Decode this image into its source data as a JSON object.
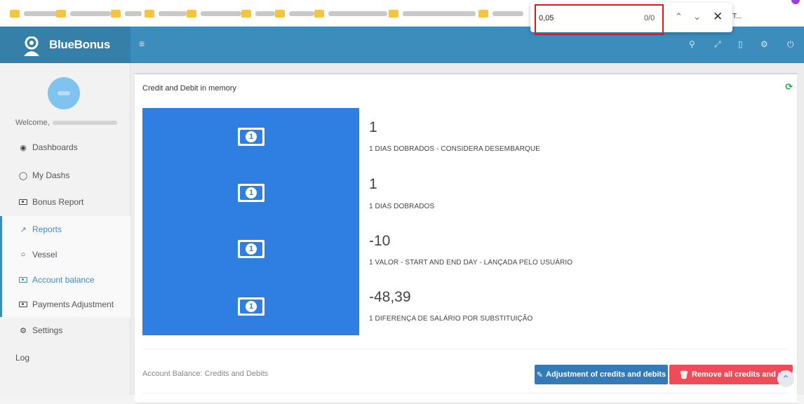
{
  "find_bar": {
    "query": "0,05",
    "count": "0/0",
    "tab_tail": "T..."
  },
  "navbar": {
    "brand": "BlueBonus",
    "icons": [
      "search-icon",
      "expand-icon",
      "window-icon",
      "settings-icon",
      "power-icon"
    ]
  },
  "sidebar": {
    "welcome": "Welcome,",
    "items": [
      {
        "label": "Dashboards",
        "icon": "dashboard-icon"
      },
      {
        "label": "My Dashs",
        "icon": "user-icon"
      },
      {
        "label": "Bonus Report",
        "icon": "money-icon"
      },
      {
        "label": "Reports",
        "icon": "chart-icon"
      },
      {
        "label": "Vessel",
        "icon": "circle-icon"
      },
      {
        "label": "Account balance",
        "icon": "money-icon"
      },
      {
        "label": "Payments Adjustment",
        "icon": "money-icon"
      },
      {
        "label": "Settings",
        "icon": "gears-icon"
      },
      {
        "label": "Log",
        "icon": ""
      }
    ]
  },
  "main": {
    "box_title": "Credit and Debit in memory",
    "stats": [
      {
        "value": "1",
        "desc": "1 DIAS DOBRADOS - CONSIDERA DESEMBARQUE"
      },
      {
        "value": "1",
        "desc": "1 DIAS DOBRADOS"
      },
      {
        "value": "-10",
        "desc": "1 VALOR - START AND END DAY - LANÇADA PELO USUÁRIO"
      },
      {
        "value": "-48,39",
        "desc": "1 DIFERENÇA DE SALÁRIO POR SUBSTITUIÇÃO"
      }
    ],
    "balance_label": "Account Balance: Credits and Debits",
    "adjust_button": "Adjustment of credits and debits",
    "remove_button": "Remove all credits and debits"
  },
  "colors": {
    "navbar": "#3c8dbc",
    "panel": "#2f7fe3",
    "adjust_btn": "#337ab7",
    "remove_btn": "#ef4c59"
  }
}
